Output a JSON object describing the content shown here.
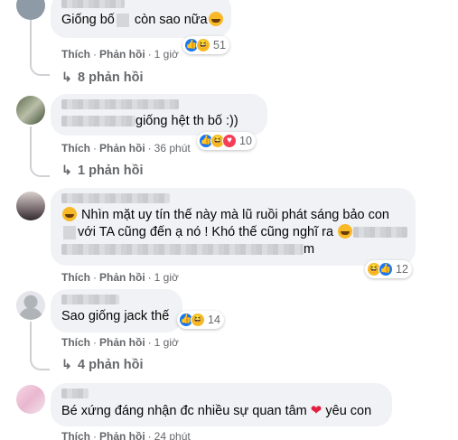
{
  "comments": [
    {
      "text_before": "Giống bố",
      "text_after": " còn sao nữa",
      "reaction_count": "51",
      "actions": {
        "like": "Thích",
        "reply": "Phản hồi",
        "time": "1 giờ"
      },
      "replies": "8 phản hồi"
    },
    {
      "text": "giống hệt th bố :))",
      "reaction_count": "10",
      "actions": {
        "like": "Thích",
        "reply": "Phản hồi",
        "time": "36 phút"
      },
      "replies": "1 phản hồi"
    },
    {
      "line1": " Nhìn mặt uy tín thế này mà lũ ruồi phát sáng bảo con",
      "line2_a": "với TA cũng đến ạ nó ! Khó thế cũng nghĩ ra",
      "line3_end": "m",
      "reaction_count": "12",
      "actions": {
        "like": "Thích",
        "reply": "Phản hồi",
        "time": "1 giờ"
      }
    },
    {
      "text": "Sao giống jack thế",
      "reaction_count": "14",
      "actions": {
        "like": "Thích",
        "reply": "Phản hồi",
        "time": "1 giờ"
      },
      "replies": "4 phản hồi"
    },
    {
      "text_before": "Bé xứng đáng nhận đc nhiều sự quan tâm ",
      "text_after": " yêu con",
      "actions": {
        "like": "Thích",
        "reply": "Phản hồi",
        "time": "24 phút"
      }
    }
  ],
  "icons": {
    "reply_arrow": "↳",
    "like": "👍",
    "haha": "😆",
    "love": "♥",
    "heart": "❤"
  },
  "colors": {
    "bubble": "#f0f2f5",
    "muted": "#65676b",
    "like_blue": "#1877f2",
    "haha_yellow": "#f7b928",
    "love_red": "#f33e58"
  }
}
